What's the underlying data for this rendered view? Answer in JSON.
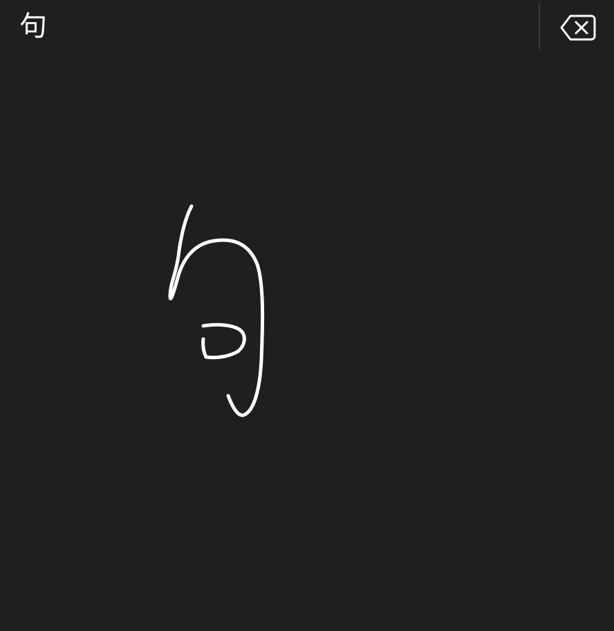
{
  "candidate_bar": {
    "candidate_text": "句"
  },
  "delete_key": {
    "icon": "delete-backward-icon"
  },
  "colors": {
    "background": "#1f1e21",
    "ink": "#ffffff",
    "divider": "#3a393d"
  }
}
